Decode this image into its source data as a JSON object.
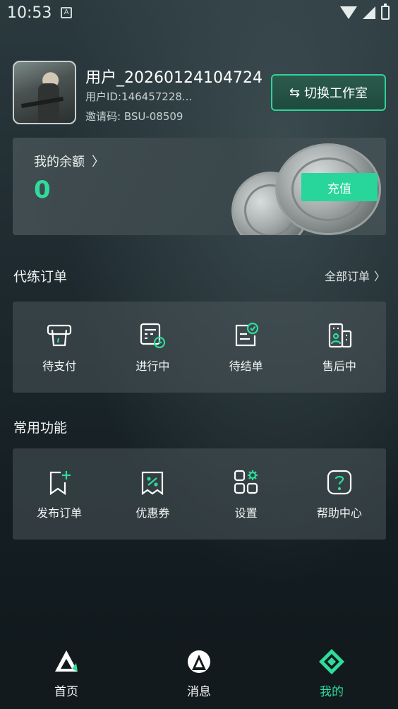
{
  "status_bar": {
    "time": "10:53",
    "notif_icon": "A"
  },
  "profile": {
    "username": "用户_20260124104724",
    "user_id": "用户ID:146457228...",
    "invite_code": "邀请码: BSU-08509",
    "switch_button": "切换工作室",
    "switch_icon": "⇆"
  },
  "balance": {
    "label": "我的余额",
    "chevron": "〉",
    "value": "0",
    "recharge_button": "充值"
  },
  "orders": {
    "title": "代练订单",
    "all_link": "全部订单",
    "chevron": "〉",
    "items": [
      {
        "label": "待支付",
        "icon": "wallet-icon"
      },
      {
        "label": "进行中",
        "icon": "calendar-clock-icon"
      },
      {
        "label": "待结单",
        "icon": "document-check-icon"
      },
      {
        "label": "售后中",
        "icon": "service-building-icon"
      }
    ]
  },
  "functions": {
    "title": "常用功能",
    "items": [
      {
        "label": "发布订单",
        "icon": "bookmark-add-icon"
      },
      {
        "label": "优惠券",
        "icon": "coupon-icon"
      },
      {
        "label": "设置",
        "icon": "settings-grid-icon"
      },
      {
        "label": "帮助中心",
        "icon": "help-icon"
      }
    ]
  },
  "bottom_nav": {
    "items": [
      {
        "label": "首页",
        "icon": "home-logo-icon"
      },
      {
        "label": "消息",
        "icon": "message-logo-icon"
      },
      {
        "label": "我的",
        "icon": "profile-logo-icon",
        "active": true
      }
    ]
  },
  "colors": {
    "accent": "#2fdc9c",
    "panel": "#3f4c50",
    "nav_bg": "#121a1d"
  }
}
